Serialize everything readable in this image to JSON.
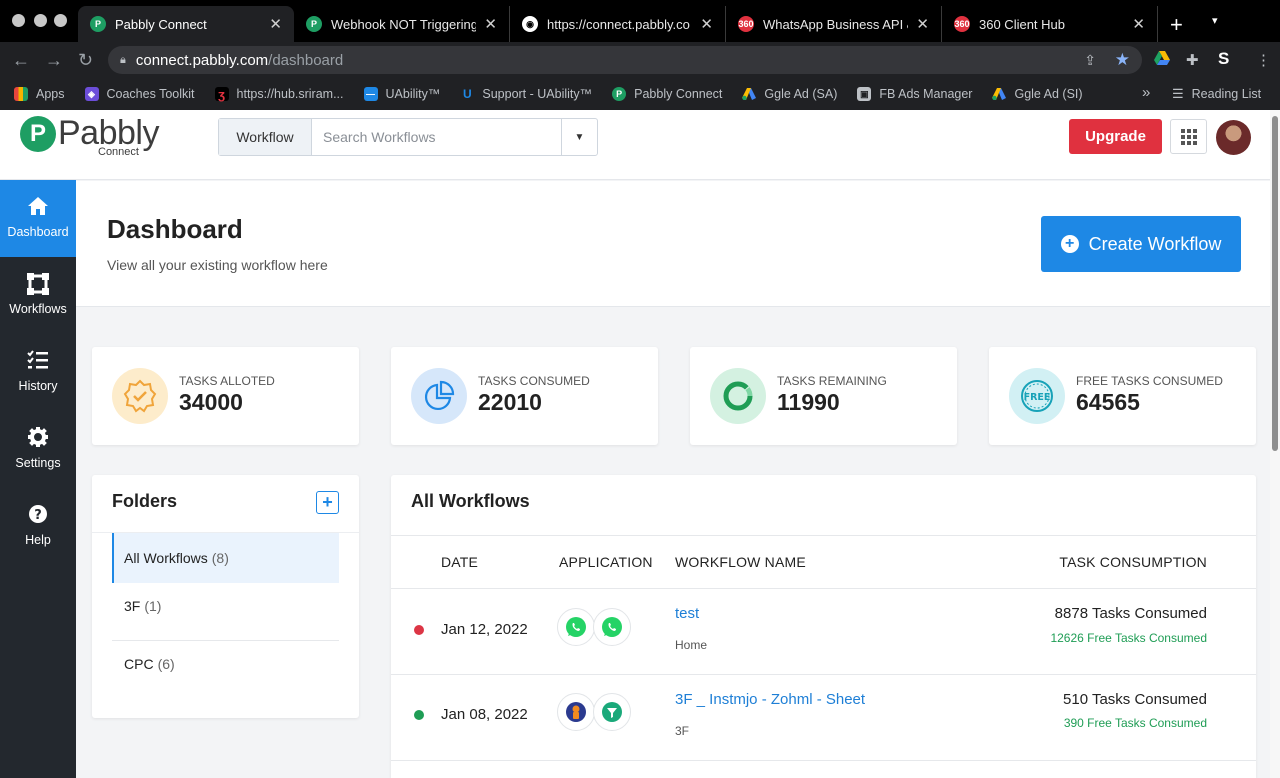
{
  "browser": {
    "tabs": [
      {
        "title": "Pabbly Connect",
        "favicon": "pabbly-icon",
        "color": "#1e9e63"
      },
      {
        "title": "Webhook NOT Triggering (",
        "favicon": "pabbly-icon",
        "color": "#1e9e63"
      },
      {
        "title": "https://connect.pabbly.co",
        "favicon": "globe-icon",
        "color": "#ffffff"
      },
      {
        "title": "WhatsApp Business API & ",
        "favicon": "360-icon",
        "color": "#e0313f"
      },
      {
        "title": "360 Client Hub",
        "favicon": "360-icon",
        "color": "#e0313f"
      }
    ],
    "url_host": "connect.pabbly.com",
    "url_path": "/dashboard",
    "bookmarks": [
      {
        "label": "Apps",
        "icon": "apps-grid-icon"
      },
      {
        "label": "Coaches Toolkit",
        "icon": "coaches-toolkit-icon"
      },
      {
        "label": "https://hub.sriram...",
        "icon": "hub-icon"
      },
      {
        "label": "UAbility™",
        "icon": "uability-icon"
      },
      {
        "label": "Support - UAbility™",
        "icon": "uability-u-icon"
      },
      {
        "label": "Pabbly Connect",
        "icon": "pabbly-icon"
      },
      {
        "label": "Ggle Ad (SA)",
        "icon": "google-ads-icon"
      },
      {
        "label": "FB Ads Manager",
        "icon": "fb-ads-icon"
      },
      {
        "label": "Ggle Ad (SI)",
        "icon": "google-ads-icon"
      }
    ],
    "more_bookmarks": "»",
    "reading_list": "Reading List"
  },
  "header": {
    "logo_word": "Pabbly",
    "logo_sub": "Connect",
    "search_scope": "Workflow",
    "search_placeholder": "Search Workflows",
    "upgrade_label": "Upgrade"
  },
  "sidebar": {
    "items": [
      {
        "label": "Dashboard",
        "icon": "home-icon",
        "active": true
      },
      {
        "label": "Workflows",
        "icon": "workflows-icon"
      },
      {
        "label": "History",
        "icon": "history-icon"
      },
      {
        "label": "Settings",
        "icon": "gear-icon"
      },
      {
        "label": "Help",
        "icon": "help-icon"
      }
    ]
  },
  "page": {
    "title": "Dashboard",
    "subtitle": "View all your existing workflow here",
    "create_label": "Create Workflow"
  },
  "stats": [
    {
      "label": "TASKS ALLOTED",
      "value": "34000",
      "icon": "badge-check-icon",
      "color": "#f0a43a"
    },
    {
      "label": "TASKS CONSUMED",
      "value": "22010",
      "icon": "pie-chart-icon",
      "color": "#1e88e5"
    },
    {
      "label": "TASKS REMAINING",
      "value": "11990",
      "icon": "donut-chart-icon",
      "color": "#1f9d55"
    },
    {
      "label": "FREE TASKS CONSUMED",
      "value": "64565",
      "icon": "free-badge-icon",
      "color": "#17a2b8"
    }
  ],
  "folders": {
    "title": "Folders",
    "items": [
      {
        "name": "All Workflows",
        "count": "(8)"
      },
      {
        "name": "3F",
        "count": "(1)"
      },
      {
        "name": "CPC",
        "count": "(6)"
      }
    ]
  },
  "workflows": {
    "title": "All Workflows",
    "columns": [
      "DATE",
      "APPLICATION",
      "WORKFLOW NAME",
      "TASK CONSUMPTION"
    ],
    "rows": [
      {
        "status_color": "#dc3545",
        "date": "Jan 12, 2022",
        "apps": [
          "whatsapp-icon",
          "whatsapp-icon"
        ],
        "name": "test",
        "folder": "Home",
        "tasks": "8878 Tasks Consumed",
        "free": "12626 Free Tasks Consumed"
      },
      {
        "status_color": "#1f9d55",
        "date": "Jan 08, 2022",
        "apps": [
          "instamojo-icon",
          "filter-icon"
        ],
        "name": "3F _ Instmjo - Zohml - Sheet",
        "folder": "3F",
        "tasks": "510 Tasks Consumed",
        "free": "390 Free Tasks Consumed"
      }
    ]
  }
}
